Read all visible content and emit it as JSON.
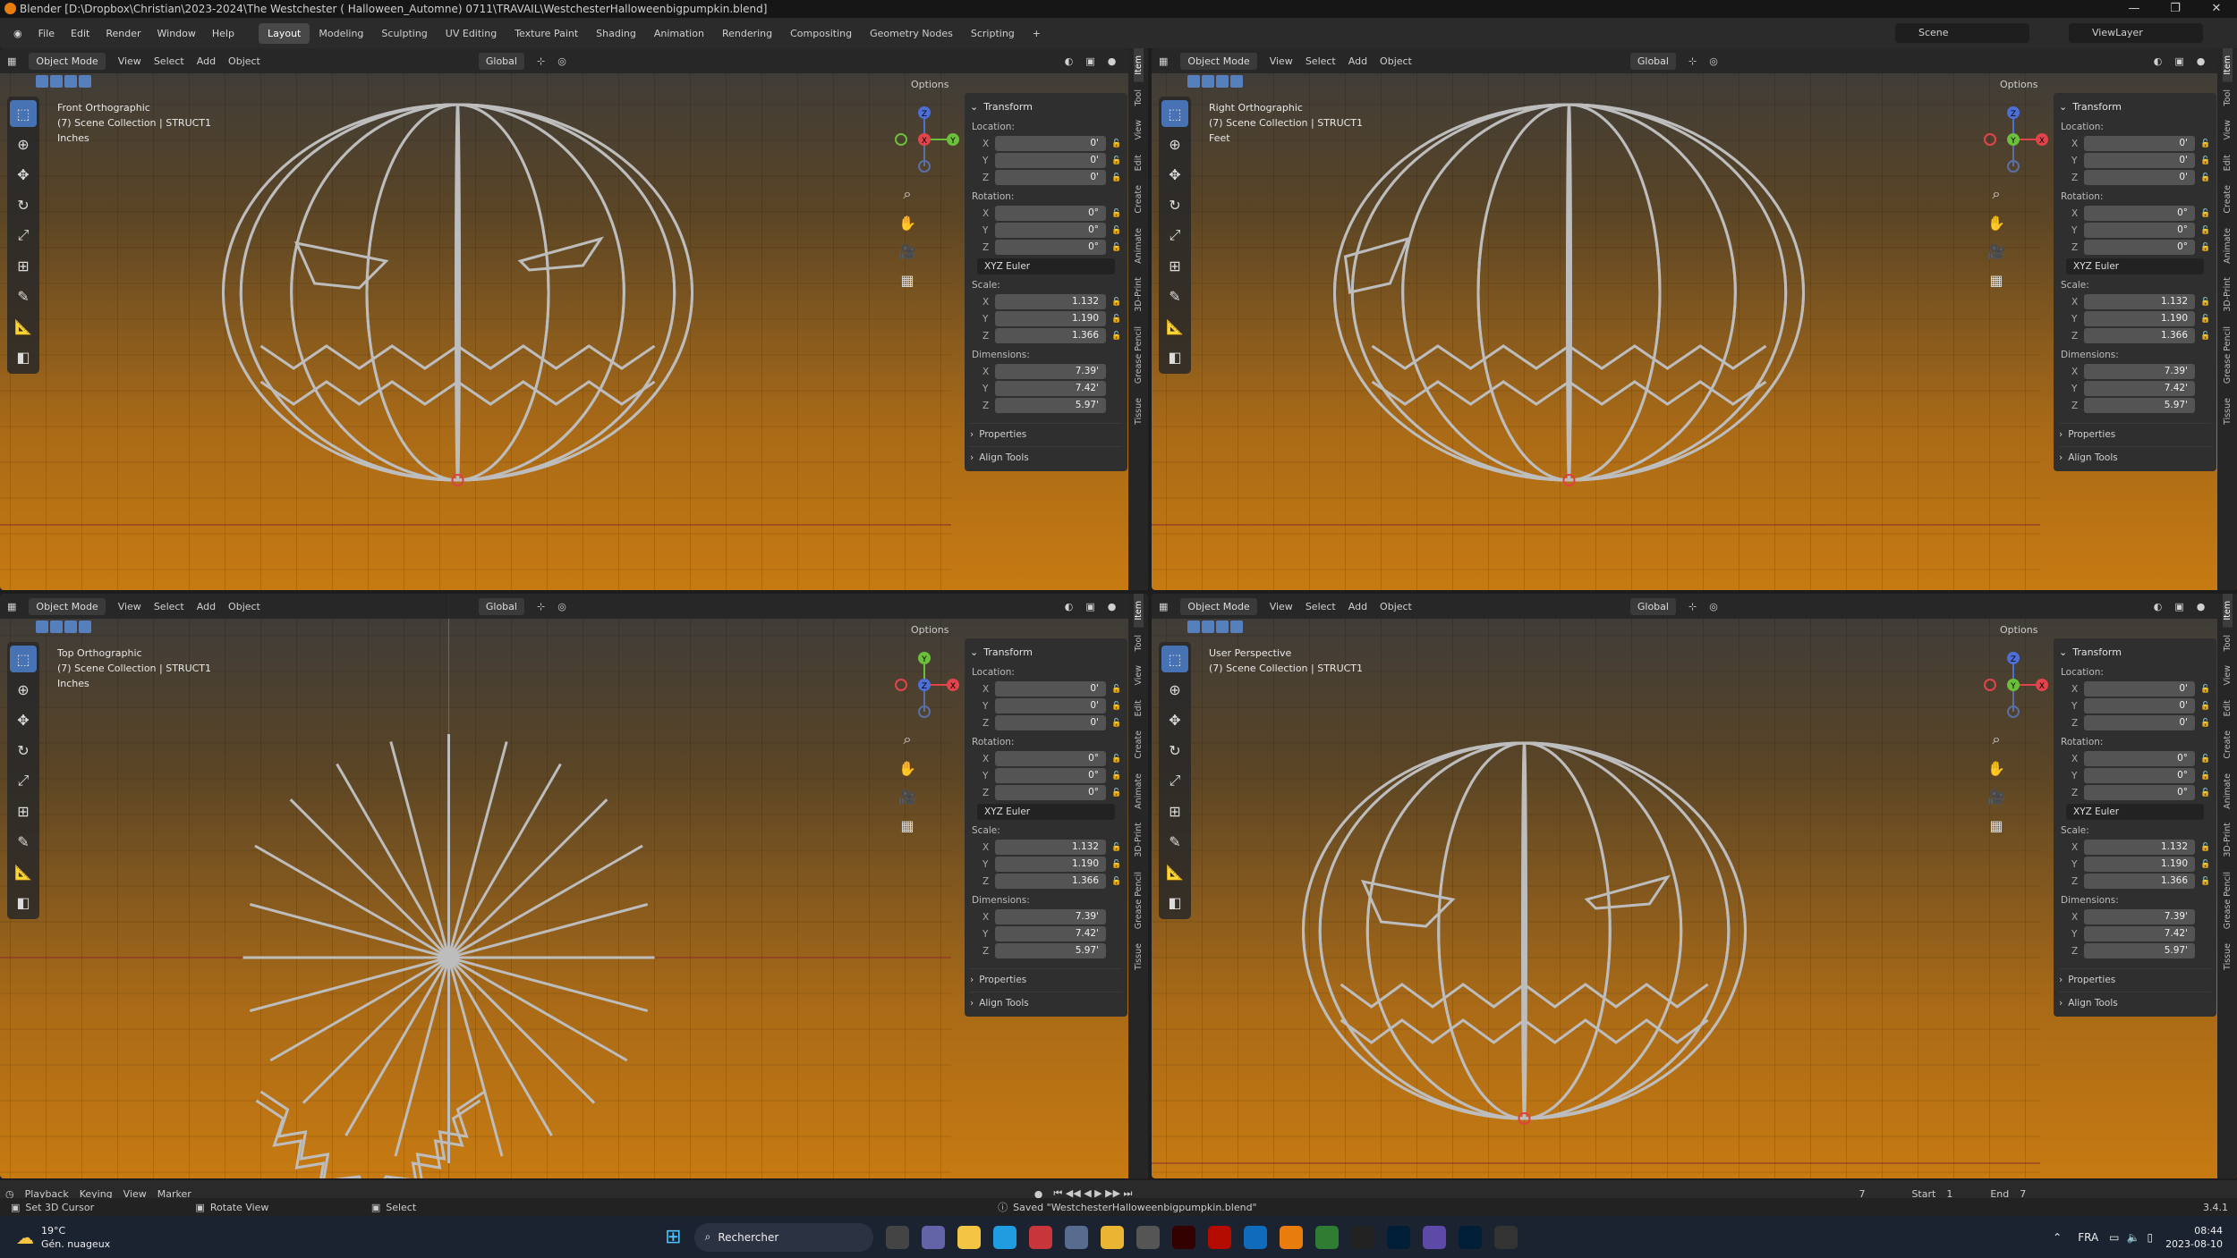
{
  "window": {
    "title": "Blender [D:\\Dropbox\\Christian\\2023-2024\\The Westchester ( Halloween_Automne) 0711\\TRAVAIL\\WestchesterHalloweenbigpumpkin.blend]",
    "controls": [
      "—",
      "❐",
      "✕"
    ]
  },
  "menu": [
    "File",
    "Edit",
    "Render",
    "Window",
    "Help"
  ],
  "workspaces": [
    "Layout",
    "Modeling",
    "Sculpting",
    "UV Editing",
    "Texture Paint",
    "Shading",
    "Animation",
    "Rendering",
    "Compositing",
    "Geometry Nodes",
    "Scripting"
  ],
  "active_workspace": "Layout",
  "scene": "Scene",
  "view_layer": "ViewLayer",
  "viewport_header": {
    "mode": "Object Mode",
    "menus": [
      "View",
      "Select",
      "Add",
      "Object"
    ],
    "orientation": "Global",
    "options": "Options"
  },
  "viewports": [
    {
      "view": "Front Orthographic",
      "collection": "(7) Scene Collection | STRUCT1",
      "units": "Inches",
      "gizmo": [
        "Z",
        "X",
        "Y"
      ]
    },
    {
      "view": "Right Orthographic",
      "collection": "(7) Scene Collection | STRUCT1",
      "units": "Feet",
      "gizmo": [
        "Z",
        "Y",
        "X"
      ]
    },
    {
      "view": "Top Orthographic",
      "collection": "(7) Scene Collection | STRUCT1",
      "units": "Inches",
      "gizmo": [
        "Y",
        "Z",
        "X"
      ]
    },
    {
      "view": "User Perspective",
      "collection": "(7) Scene Collection | STRUCT1",
      "units": "",
      "gizmo": [
        "Z",
        "Y",
        "X"
      ]
    }
  ],
  "transform": {
    "title": "Transform",
    "location_label": "Location:",
    "rotation_label": "Rotation:",
    "scale_label": "Scale:",
    "dimensions_label": "Dimensions:",
    "location": [
      "0'",
      "0'",
      "0'"
    ],
    "rotation": [
      "0°",
      "0°",
      "0°"
    ],
    "rotation_mode": "XYZ Euler",
    "scale": [
      "1.132",
      "1.190",
      "1.366"
    ],
    "dimensions": [
      "7.39'",
      "7.42'",
      "5.97'"
    ],
    "axes": [
      "X",
      "Y",
      "Z"
    ],
    "properties": "Properties",
    "align_tools": "Align Tools"
  },
  "sidebar_tabs": [
    "Item",
    "Tool",
    "View",
    "Edit",
    "Create",
    "Animate",
    "3D-Print",
    "Grease Pencil",
    "Tissue"
  ],
  "timeline": {
    "menus": [
      "Playback",
      "Keying",
      "View",
      "Marker"
    ],
    "current_frame": "7",
    "start_label": "Start",
    "start": "1",
    "end_label": "End",
    "end": "7"
  },
  "status": {
    "left1": "Set 3D Cursor",
    "left2": "Rotate View",
    "left3": "Select",
    "message": "Saved \"WestchesterHalloweenbigpumpkin.blend\"",
    "version": "3.4.1"
  },
  "taskbar": {
    "weather_temp": "19°C",
    "weather_desc": "Gén. nuageux",
    "search": "Rechercher",
    "lang": "FRA",
    "time": "08:44",
    "date": "2023-08-10"
  }
}
